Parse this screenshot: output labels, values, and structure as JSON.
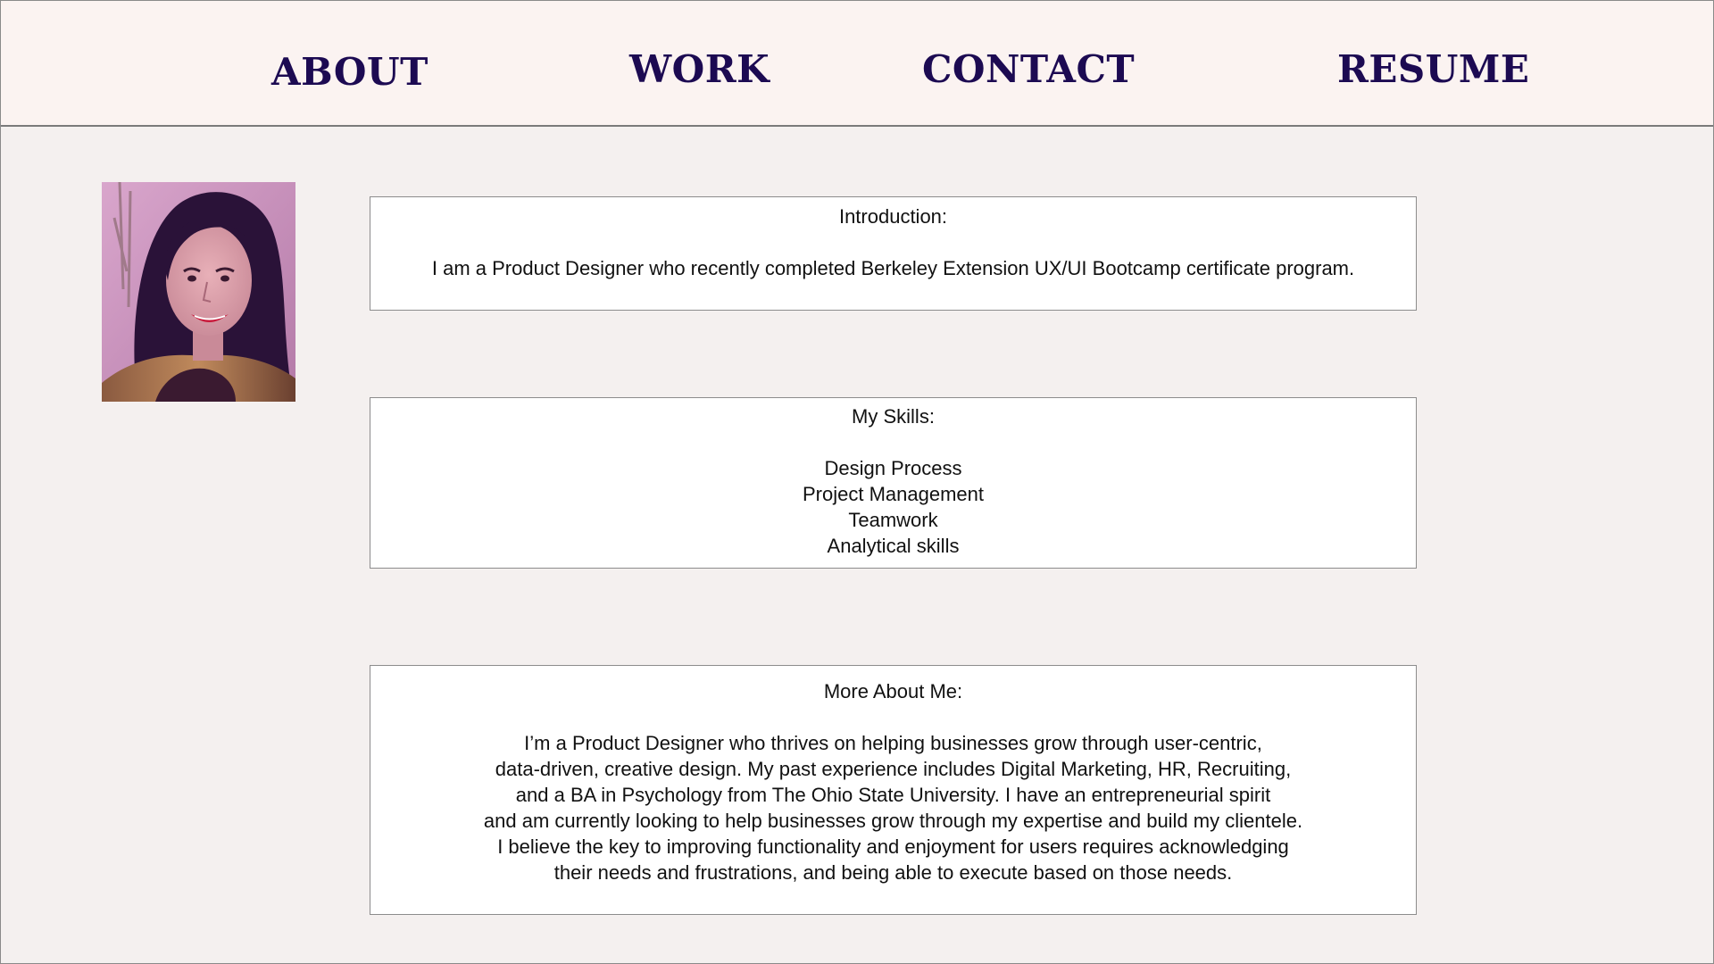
{
  "nav": {
    "items": [
      {
        "label": "ABOUT"
      },
      {
        "label": "WORK"
      },
      {
        "label": "CONTACT"
      },
      {
        "label": "RESUME"
      }
    ]
  },
  "intro": {
    "title": "Introduction:",
    "text": "I am a Product Designer who recently completed Berkeley Extension UX/UI Bootcamp certificate program."
  },
  "skills": {
    "title": "My Skills:",
    "items": [
      "Design Process",
      "Project Management",
      "Teamwork",
      "Analytical skills"
    ]
  },
  "more": {
    "title": "More About Me:",
    "lines": [
      "I’m a Product Designer who thrives on helping businesses grow through user-centric,",
      "data-driven, creative design. My past experience includes Digital Marketing, HR, Recruiting,",
      "and a BA in Psychology from The Ohio State University. I have an entrepreneurial spirit",
      "and am currently looking to help businesses grow through my expertise and build my clientele.",
      "I believe the key to improving functionality and enjoyment for users requires acknowledging",
      "their needs and frustrations, and being able to execute based on those needs."
    ]
  },
  "colors": {
    "nav_text": "#1c0a52",
    "nav_bg": "#fbf3f1",
    "page_bg": "#f4f0ef"
  }
}
